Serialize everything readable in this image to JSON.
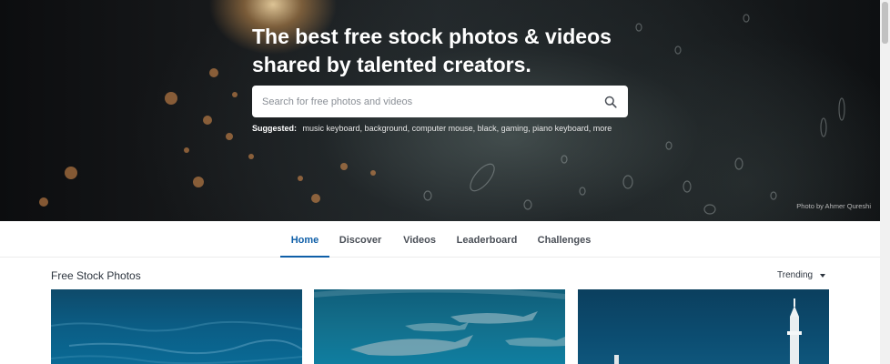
{
  "hero": {
    "title_line1": "The best free stock photos & videos",
    "title_line2": "shared by talented creators.",
    "search_placeholder": "Search for free photos and videos",
    "suggested_label": "Suggested:",
    "suggested_items": "music keyboard, background, computer mouse, black, gaming, piano keyboard, more",
    "credit": "Photo by Ahmer Qureshi"
  },
  "nav": {
    "tabs": [
      {
        "label": "Home",
        "active": true
      },
      {
        "label": "Discover",
        "active": false
      },
      {
        "label": "Videos",
        "active": false
      },
      {
        "label": "Leaderboard",
        "active": false
      },
      {
        "label": "Challenges",
        "active": false
      }
    ]
  },
  "section": {
    "title": "Free Stock Photos",
    "sort_label": "Trending"
  },
  "icons": {
    "search": "search-icon",
    "sort_caret": "caret-down-icon"
  },
  "colors": {
    "accent": "#0f5fa8",
    "text": "#2c343e"
  }
}
